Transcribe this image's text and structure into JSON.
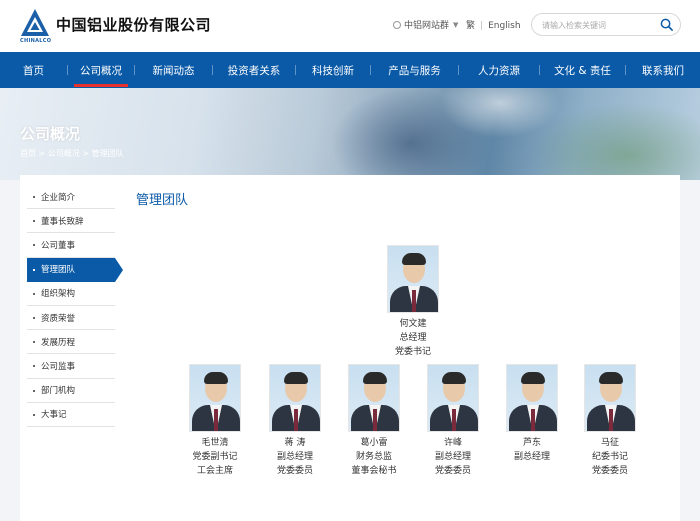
{
  "header": {
    "logo_text": "中国铝业股份有限公司",
    "logo_sub": "CHINALCO",
    "site_group": "中铝网站群",
    "lang_trad": "繁",
    "lang_en": "English",
    "search_placeholder": "请输入检索关键词"
  },
  "nav": {
    "items": [
      {
        "label": "首页"
      },
      {
        "label": "公司概况"
      },
      {
        "label": "新闻动态"
      },
      {
        "label": "投资者关系"
      },
      {
        "label": "科技创新"
      },
      {
        "label": "产品与服务"
      },
      {
        "label": "人力资源"
      },
      {
        "label": "文化 & 责任"
      },
      {
        "label": "联系我们"
      }
    ],
    "active_index": 1
  },
  "banner": {
    "title": "公司概况",
    "breadcrumb": "首页 > 公司概况 > 管理团队"
  },
  "sidebar": {
    "items": [
      {
        "label": "企业简介"
      },
      {
        "label": "董事长致辞"
      },
      {
        "label": "公司董事"
      },
      {
        "label": "管理团队"
      },
      {
        "label": "组织架构"
      },
      {
        "label": "资质荣誉"
      },
      {
        "label": "发展历程"
      },
      {
        "label": "公司监事"
      },
      {
        "label": "部门机构"
      },
      {
        "label": "大事记"
      }
    ],
    "active_index": 3
  },
  "main": {
    "title": "管理团队",
    "leader": {
      "name": "何文建",
      "titles": [
        "总经理",
        "党委书记"
      ]
    },
    "members": [
      {
        "name": "毛世清",
        "titles": [
          "党委副书记",
          "工会主席"
        ]
      },
      {
        "name": "蒋 涛",
        "titles": [
          "副总经理",
          "党委委员"
        ]
      },
      {
        "name": "葛小雷",
        "titles": [
          "财务总监",
          "董事会秘书"
        ]
      },
      {
        "name": "许峰",
        "titles": [
          "副总经理",
          "党委委员"
        ]
      },
      {
        "name": "芦东",
        "titles": [
          "副总经理"
        ]
      },
      {
        "name": "马征",
        "titles": [
          "纪委书记",
          "党委委员"
        ]
      }
    ]
  },
  "colors": {
    "brand_blue": "#0a5aa8",
    "active_underline": "#e5322d"
  }
}
